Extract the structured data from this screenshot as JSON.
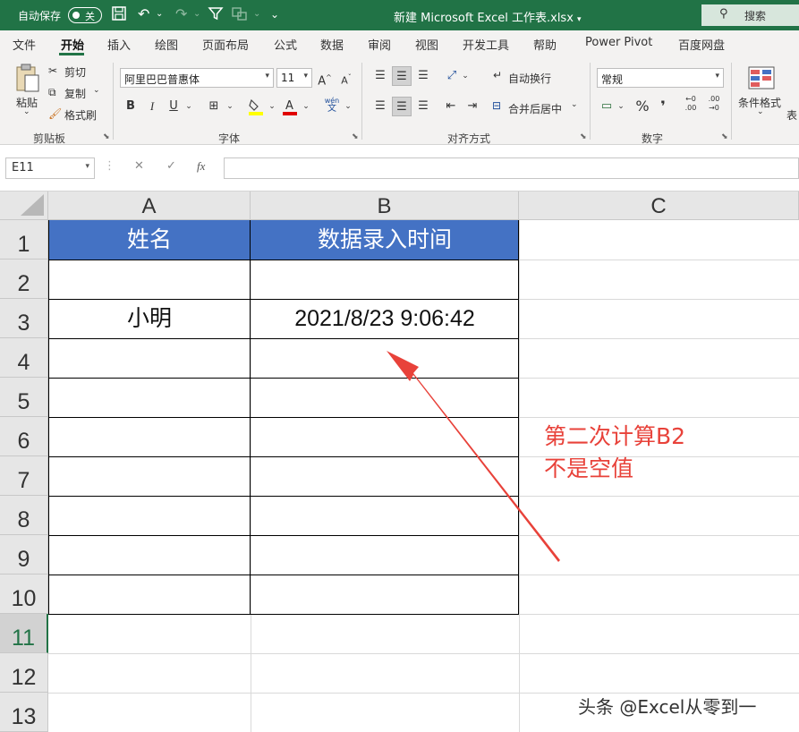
{
  "titlebar": {
    "autosave_label": "自动保存",
    "autosave_state": "关",
    "doc_title": "新建 Microsoft Excel 工作表.xlsx",
    "search_label": "搜索",
    "qa_icons": [
      "save-icon",
      "undo-icon",
      "redo-icon",
      "filter-icon",
      "form-icon",
      "customize-icon"
    ]
  },
  "menu": {
    "tabs": [
      "文件",
      "开始",
      "插入",
      "绘图",
      "页面布局",
      "公式",
      "数据",
      "审阅",
      "视图",
      "开发工具",
      "帮助",
      "Power Pivot",
      "百度网盘"
    ],
    "active_tab": "开始"
  },
  "ribbon": {
    "clipboard": {
      "paste": "粘贴",
      "cut": "剪切",
      "copy": "复制",
      "format_painter": "格式刷",
      "label": "剪贴板"
    },
    "font": {
      "name": "阿里巴巴普惠体",
      "size": "11",
      "grow": "A",
      "shrink": "A",
      "bold": "B",
      "italic": "I",
      "underline": "U",
      "phonetic_top": "wén",
      "phonetic_bottom": "文",
      "label": "字体"
    },
    "alignment": {
      "wrap_text": "自动换行",
      "merge_center": "合并后居中",
      "label": "对齐方式"
    },
    "number": {
      "format": "常规",
      "percent": "%",
      "comma": "❜",
      "inc_decimal_top": "←0",
      "inc_decimal_bottom": ".00",
      "dec_decimal_top": ".00",
      "dec_decimal_bottom": "→0",
      "label": "数字"
    },
    "styles": {
      "conditional": "条件格式",
      "table_partial": "表"
    }
  },
  "formula_bar": {
    "name_box": "E11",
    "cancel": "✕",
    "enter": "✓",
    "fx": "fx",
    "value": ""
  },
  "sheet": {
    "columns": [
      "A",
      "B",
      "C"
    ],
    "rows": [
      "1",
      "2",
      "3",
      "4",
      "5",
      "6",
      "7",
      "8",
      "9",
      "10",
      "11",
      "12",
      "13"
    ],
    "selected_row": "11",
    "header": [
      "姓名",
      "数据录入时间"
    ],
    "data": {
      "A3": "小明",
      "B3": "2021/8/23 9:06:42"
    }
  },
  "annotation": {
    "text": "第二次计算B2\n不是空值",
    "color": "#e8423a"
  },
  "watermark": "头条 @Excel从零到一",
  "colors": {
    "excel_green": "#217346",
    "header_blue": "#4472c4"
  }
}
